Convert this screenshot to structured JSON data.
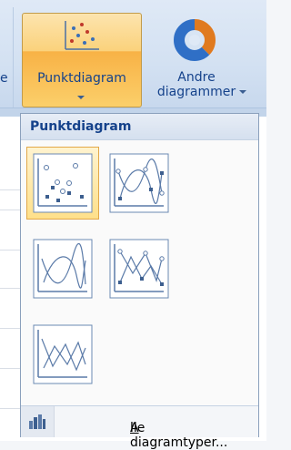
{
  "ribbon": {
    "partial_label": "e",
    "scatter_button_label": "Punktdiagram",
    "other_button_line1": "Andre",
    "other_button_line2": "diagrammer"
  },
  "dropdown": {
    "header": "Punktdiagram",
    "thumbnails": [
      {
        "name": "scatter-markers-only",
        "selected": true
      },
      {
        "name": "scatter-smooth-lines-markers",
        "selected": false
      },
      {
        "name": "scatter-smooth-lines",
        "selected": false
      },
      {
        "name": "scatter-straight-lines-markers",
        "selected": false
      },
      {
        "name": "scatter-straight-lines",
        "selected": false
      }
    ],
    "footer_mnemonic": "A",
    "footer_rest": "lle diagramtyper..."
  },
  "colors": {
    "accent_orange": "#f8b246",
    "ribbon_blue": "#d3e1f2",
    "text_blue": "#15428b"
  }
}
